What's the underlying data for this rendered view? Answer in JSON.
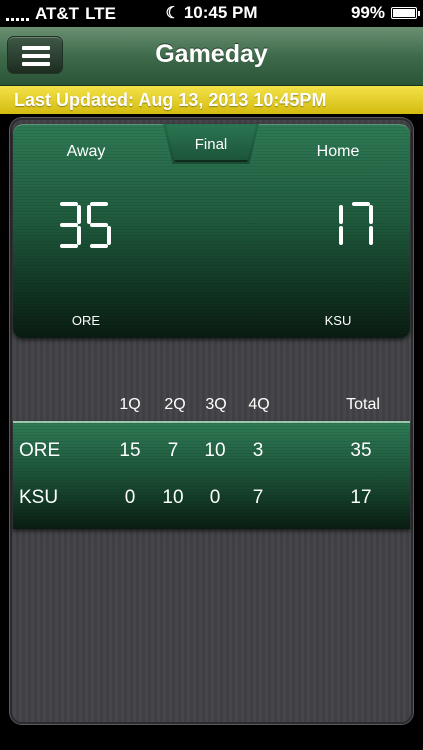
{
  "status_bar": {
    "carrier": "AT&T",
    "network": "LTE",
    "time": "10:45 PM",
    "battery": "99%",
    "battery_level": 0.99
  },
  "nav": {
    "title": "Gameday"
  },
  "updated": {
    "text": "Last Updated: Aug 13, 2013 10:45PM"
  },
  "scoreboard": {
    "status": "Final",
    "away_label": "Away",
    "home_label": "Home",
    "away_score": "35",
    "home_score": "17",
    "away_team": "ORE",
    "home_team": "KSU"
  },
  "box_score": {
    "columns": [
      "1Q",
      "2Q",
      "3Q",
      "4Q",
      "Total"
    ],
    "rows": [
      {
        "team": "ORE",
        "q": [
          "15",
          "7",
          "10",
          "3"
        ],
        "total": "35"
      },
      {
        "team": "KSU",
        "q": [
          "0",
          "10",
          "0",
          "7"
        ],
        "total": "17"
      }
    ]
  },
  "colors": {
    "nav_green": "#3e6b4b",
    "score_green": "#1f5a3d",
    "updated_yellow": "#e5cf22",
    "panel_gray": "#434348"
  }
}
